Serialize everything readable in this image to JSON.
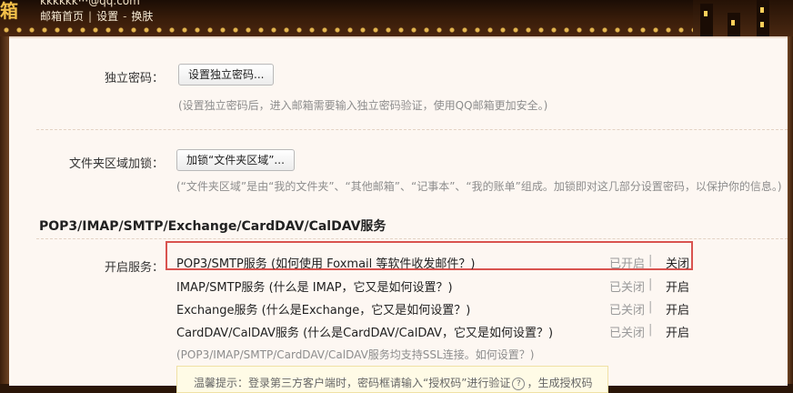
{
  "header": {
    "logo_text": "箱",
    "account": "kkkkkk···@qq.com",
    "nav": [
      {
        "label": "邮箱首页"
      },
      {
        "label": "设置"
      },
      {
        "label": "换肤"
      }
    ]
  },
  "independent_password": {
    "label": "独立密码：",
    "button": "设置独立密码...",
    "hint": "(设置独立密码后，进入邮箱需要输入独立密码验证，使用QQ邮箱更加安全。)"
  },
  "folder_lock": {
    "label": "文件夹区域加锁：",
    "button": "加锁“文件夹区域”...",
    "hint": "(“文件夹区域”是由“我的文件夹”、“其他邮箱”、“记事本”、“我的账单”组成。加锁即对这几部分设置密码，以保护你的信息。)"
  },
  "section": {
    "title": "POP3/IMAP/SMTP/Exchange/CardDAV/CalDAV服务",
    "enable_label": "开启服务：",
    "services": [
      {
        "name": "POP3/SMTP服务",
        "help": "(如何使用 Foxmail 等软件收发邮件？)",
        "status": "已开启",
        "action": "关闭"
      },
      {
        "name": "IMAP/SMTP服务",
        "help": "(什么是 IMAP，它又是如何设置？)",
        "status": "已关闭",
        "action": "开启"
      },
      {
        "name": "Exchange服务",
        "help": "(什么是Exchange，它又是如何设置？)",
        "status": "已关闭",
        "action": "开启"
      },
      {
        "name": "CardDAV/CalDAV服务",
        "help": "(什么是CardDAV/CalDAV，它又是如何设置？)",
        "status": "已关闭",
        "action": "开启"
      }
    ],
    "ssl_note": "(POP3/IMAP/SMTP/CardDAV/CalDAV服务均支持SSL连接。如何设置？)",
    "tip": "温馨提示：登录第三方客户端时，密码框请输入“授权码”进行验证",
    "tip_suffix": "，生成授权码"
  },
  "colors": {
    "highlight_border": "#d9534f",
    "panel_bg": "#fdf7f2",
    "status_gray": "#9a9a9a"
  }
}
